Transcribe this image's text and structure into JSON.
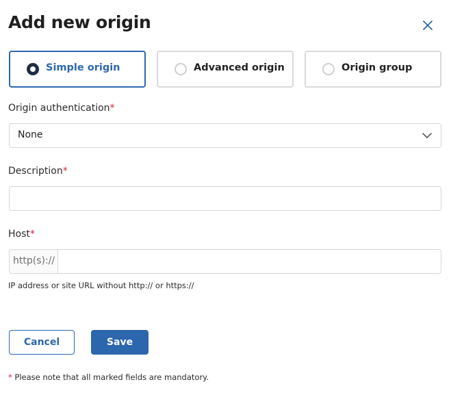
{
  "dialog": {
    "title": "Add new origin",
    "close_icon": "close-icon"
  },
  "origin_types": [
    {
      "label": "Simple origin",
      "selected": true
    },
    {
      "label": "Advanced origin",
      "selected": false
    },
    {
      "label": "Origin group",
      "selected": false
    }
  ],
  "fields": {
    "authentication": {
      "label": "Origin authentication",
      "required_mark": "*",
      "value": "None",
      "icon": "chevron-down-icon"
    },
    "description": {
      "label": "Description",
      "required_mark": "*",
      "value": "",
      "placeholder": ""
    },
    "host": {
      "label": "Host",
      "required_mark": "*",
      "prefix": "http(s)://",
      "value": "",
      "placeholder": "",
      "hint": "IP address or site URL without http:// or https://"
    }
  },
  "actions": {
    "cancel_label": "Cancel",
    "save_label": "Save"
  },
  "footnote": {
    "mark": "*",
    "text": " Please note that all marked fields are mandatory."
  },
  "colors": {
    "accent": "#2c66ad",
    "required": "#d6243b",
    "border": "#d6d6d6"
  }
}
